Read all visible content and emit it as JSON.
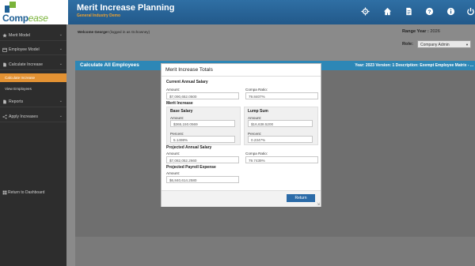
{
  "header": {
    "logo_main": "Comp",
    "logo_accent": "ease",
    "title": "Merit Increase Planning",
    "subtitle": "General Industry Demo",
    "icons": [
      "gear-icon",
      "home-icon",
      "document-icon",
      "help-icon",
      "info-icon",
      "power-icon"
    ]
  },
  "sidebar": {
    "items": [
      {
        "label": "Merit Model",
        "icon": "star-icon"
      },
      {
        "label": "Employee Model",
        "icon": "calendar-icon"
      },
      {
        "label": "Calculate Increase",
        "icon": "document-icon"
      },
      {
        "label": "Reports",
        "icon": "document-icon"
      },
      {
        "label": "Apply Increases",
        "icon": "share-icon"
      }
    ],
    "subitems": [
      {
        "label": "Calculate Increase"
      },
      {
        "label": "View Employees"
      }
    ],
    "return_label": "Return to Dashboard"
  },
  "main": {
    "welcome_prefix": "Welcome",
    "welcome_user": "George!",
    "welcome_suffix": "(logged in as Gchowney)",
    "range_label": "Range Year :",
    "range_value": "2026",
    "role_label": "Role:",
    "role_value": "Company Admin",
    "calc_title": "Calculate All Employees",
    "calc_info": "Year: 2023  Version: 1  Description: Exempt Employee Matrix - ..."
  },
  "modal": {
    "title": "Merit Increase Totals",
    "current_salary": {
      "title": "Current Annual Salary",
      "amount_label": "Amount:",
      "amount": "$7,090,652.0500",
      "compa_label": "Compa Ratio:",
      "compa": "79.8407%"
    },
    "merit_increase": {
      "title": "Merit Increase",
      "base": {
        "title": "Base Salary",
        "amount_label": "Amount:",
        "amount": "$365,150.0569",
        "percent_label": "Percent:",
        "percent": "5.1498%"
      },
      "lump": {
        "title": "Lump Sum",
        "amount_label": "Amount:",
        "amount": "$16,638.5200",
        "percent_label": "Percent:",
        "percent": "0.2347%"
      }
    },
    "projected_salary": {
      "title": "Projected Annual Salary",
      "amount_label": "Amount:",
      "amount": "$7,082,052.2660",
      "compa_label": "Compa Ratio:",
      "compa": "79.7439%"
    },
    "projected_payroll": {
      "title": "Projected Payroll Expense",
      "amount_label": "Amount:",
      "amount": "$6,840,614.2580"
    },
    "return_label": "Return"
  }
}
